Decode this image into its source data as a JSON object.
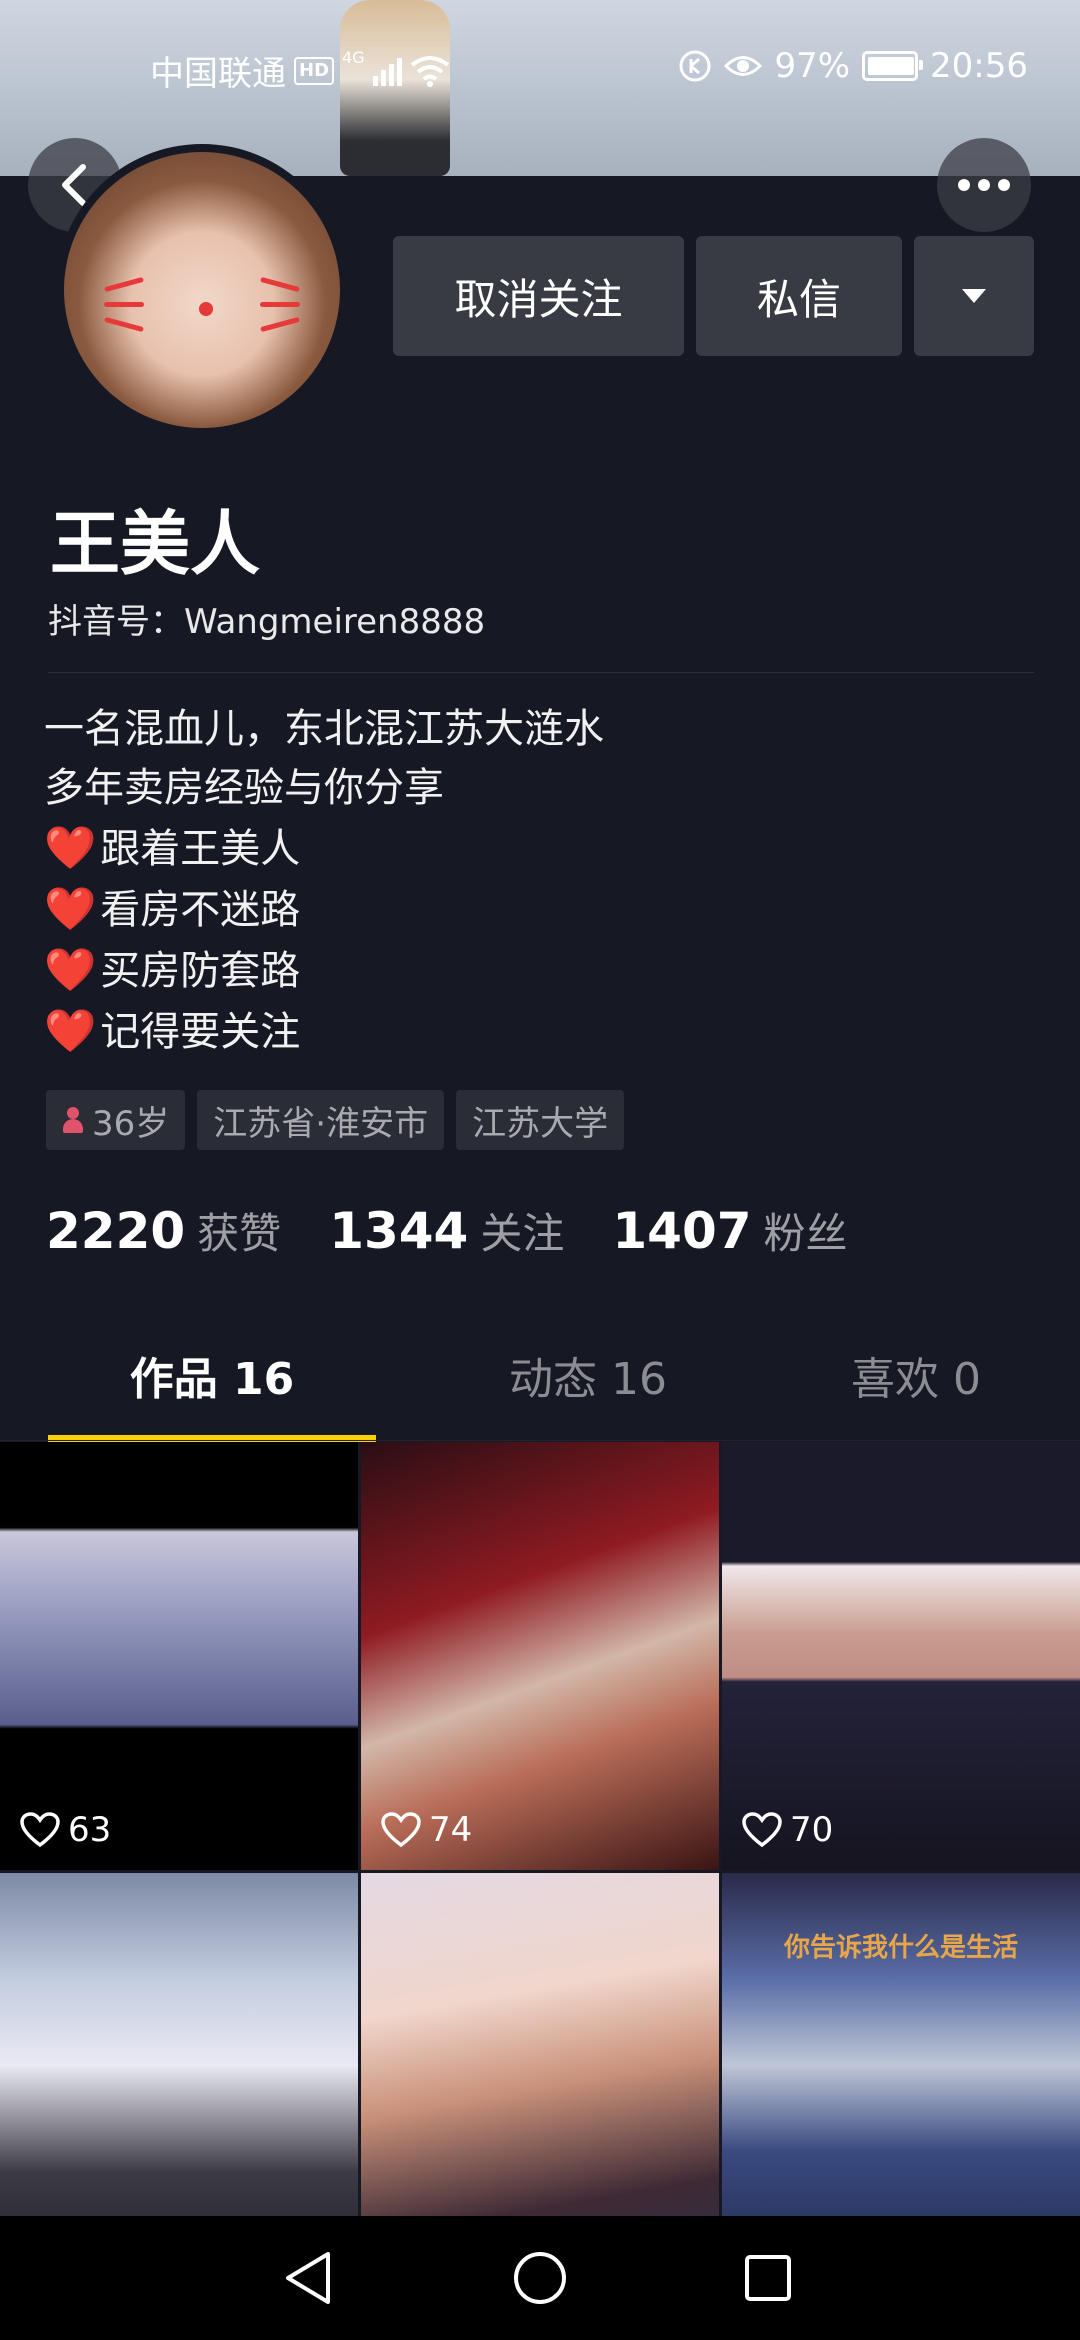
{
  "status_bar": {
    "carrier": "中国联通",
    "hd": "HD",
    "network": "4G",
    "battery": "97%",
    "time": "20:56"
  },
  "header": {
    "back_icon": "chevron-left-icon",
    "more_icon": "more-dots-icon"
  },
  "actions": {
    "unfollow_label": "取消关注",
    "message_label": "私信",
    "dropdown_icon": "caret-down-icon"
  },
  "profile": {
    "name": "王美人",
    "douyin_id": "抖音号：Wangmeiren8888",
    "bio": [
      "一名混血儿，东北混江苏大涟水",
      "多年卖房经验与你分享"
    ],
    "bio_hearts": [
      "跟着王美人",
      "看房不迷路",
      "买房防套路",
      "记得要关注"
    ],
    "heart_emoji": "❤️",
    "tags": {
      "age": "36岁",
      "location": "江苏省·淮安市",
      "school": "江苏大学"
    }
  },
  "stats": [
    {
      "value": "2220",
      "label": "获赞"
    },
    {
      "value": "1344",
      "label": "关注"
    },
    {
      "value": "1407",
      "label": "粉丝"
    }
  ],
  "tabs": [
    {
      "label": "作品 16",
      "active": true
    },
    {
      "label": "动态 16",
      "active": false
    },
    {
      "label": "喜欢 0",
      "active": false
    }
  ],
  "videos": [
    {
      "likes": "63"
    },
    {
      "likes": "74"
    },
    {
      "likes": "70"
    },
    {
      "likes": ""
    },
    {
      "likes": ""
    },
    {
      "likes": "",
      "overlay_text": "你告诉我什么是生活"
    }
  ],
  "colors": {
    "background": "#161823",
    "tab_indicator": "#fbcf0a",
    "button_bg": "#393b44"
  }
}
